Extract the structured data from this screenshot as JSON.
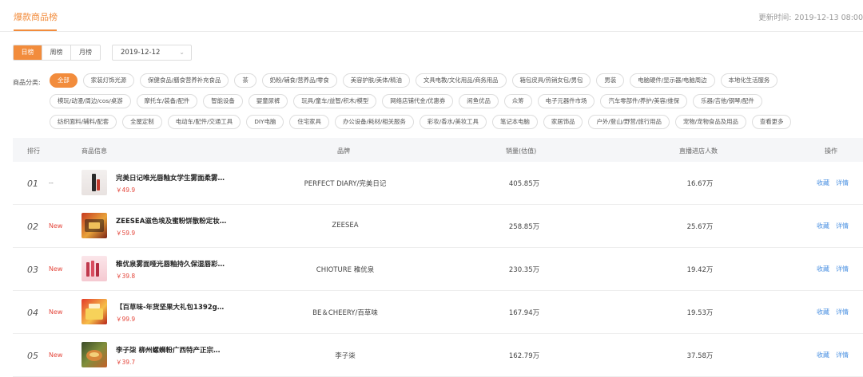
{
  "header": {
    "title": "爆款商品榜",
    "update_label": "更新时间:",
    "update_value": "2019-12-13 08:00"
  },
  "tabs": [
    "日榜",
    "周榜",
    "月榜"
  ],
  "active_tab": 0,
  "date": {
    "value": "2019-12-12"
  },
  "categories": {
    "label": "商品分类:",
    "rows": [
      [
        "全部",
        "家装灯饰光源",
        "保健食品/膳食营养补充食品",
        "茶",
        "奶粉/辅食/营养品/零食",
        "美容护肤/美体/精油",
        "文具电教/文化用品/商务用品",
        "箱包皮具/热销女包/男包",
        "男装",
        "电脑硬件/显示器/电脑周边",
        "本地化生活服务"
      ],
      [
        "模玩/动漫/周边/cos/桌游",
        "摩托车/装备/配件",
        "智能设备",
        "婴童尿裤",
        "玩具/童车/益智/积木/模型",
        "网络店铺代金/优惠券",
        "闲鱼优品",
        "众筹",
        "电子元器件市场",
        "汽车零部件/养护/美容/维保",
        "乐器/吉他/钢琴/配件"
      ],
      [
        "纺织面料/辅料/配套",
        "全屋定制",
        "电动车/配件/交通工具",
        "DIY电脑",
        "住宅家具",
        "办公设备/耗材/相关服务",
        "彩妆/香水/美妆工具",
        "笔记本电脑",
        "家居饰品",
        "户外/登山/野营/旅行用品",
        "宠物/宠物食品及用品",
        "查看更多"
      ]
    ]
  },
  "table": {
    "columns": [
      "排行",
      "商品信息",
      "品牌",
      "销量(估值)",
      "直播进店人数",
      "操作"
    ],
    "op_collect": "收藏",
    "op_detail": "详情",
    "rows": [
      {
        "rank": "01",
        "trend": "--",
        "name": "完美日记唯光唇釉女学生雾面柔雾…",
        "price": "￥49.9",
        "brand": "PERFECT DIARY/完美日记",
        "sales": "405.85万",
        "viewers": "16.67万"
      },
      {
        "rank": "02",
        "trend": "New",
        "name": "ZEESEA滋色埃及蜜粉饼散粉定妆…",
        "price": "￥59.9",
        "brand": "ZEESEA",
        "sales": "258.85万",
        "viewers": "25.67万"
      },
      {
        "rank": "03",
        "trend": "New",
        "name": "稚优泉雾面哑光唇釉持久保湿唇彩…",
        "price": "￥39.8",
        "brand": "CHIOTURE 稚优泉",
        "sales": "230.35万",
        "viewers": "19.42万"
      },
      {
        "rank": "04",
        "trend": "New",
        "name": "【百草味-年货坚果大礼包1392g…",
        "price": "￥99.9",
        "brand": "BE＆CHEERY/百草味",
        "sales": "167.94万",
        "viewers": "19.53万"
      },
      {
        "rank": "05",
        "trend": "New",
        "name": "李子柒 柳州螺蛳粉广西特产正宗…",
        "price": "￥39.7",
        "brand": "李子柒",
        "sales": "162.79万",
        "viewers": "37.58万"
      }
    ]
  },
  "colors": {
    "accent": "#f28c3c",
    "price": "#e4463b",
    "link": "#4a90e2"
  }
}
